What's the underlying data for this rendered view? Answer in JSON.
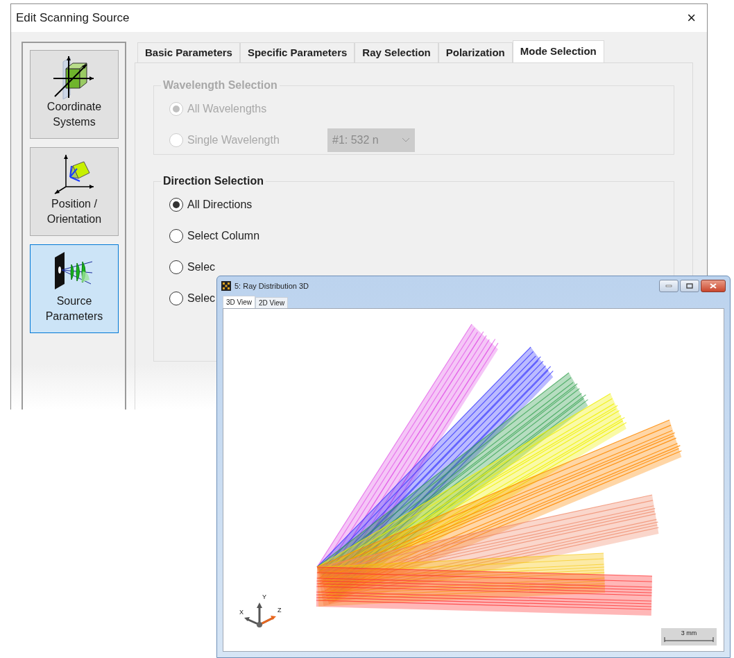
{
  "dialog": {
    "title": "Edit Scanning Source",
    "close": "×",
    "sidebar": [
      {
        "label": "Coordinate Systems",
        "kind": "coordinates",
        "selected": false
      },
      {
        "label": "Position / Orientation",
        "kind": "position",
        "selected": false
      },
      {
        "label": "Source Parameters",
        "kind": "source",
        "selected": true
      }
    ],
    "tabs": [
      {
        "label": "Basic Parameters",
        "selected": false
      },
      {
        "label": "Specific Parameters",
        "selected": false
      },
      {
        "label": "Ray Selection",
        "selected": false
      },
      {
        "label": "Polarization",
        "selected": false
      },
      {
        "label": "Mode Selection",
        "selected": true
      }
    ],
    "groups": [
      {
        "title": "Wavelength Selection",
        "disabled": true,
        "options": [
          {
            "label": "All Wavelengths",
            "checked": true
          },
          {
            "label": "Single Wavelength",
            "checked": false,
            "dropdown": "#1: 532 n"
          }
        ]
      },
      {
        "title": "Direction Selection",
        "disabled": false,
        "options": [
          {
            "label": "All Directions",
            "checked": true
          },
          {
            "label": "Select Column",
            "checked": false
          },
          {
            "label": "Selec",
            "checked": false
          },
          {
            "label": "Selec",
            "checked": false
          }
        ]
      }
    ]
  },
  "plot_window": {
    "title": "5: Ray Distribution 3D",
    "tabs": [
      {
        "label": "3D View",
        "selected": true
      },
      {
        "label": "2D View",
        "selected": false
      }
    ],
    "axes": {
      "x": "X",
      "y": "Y",
      "z": "Z"
    },
    "scale_bar": "3 mm"
  }
}
